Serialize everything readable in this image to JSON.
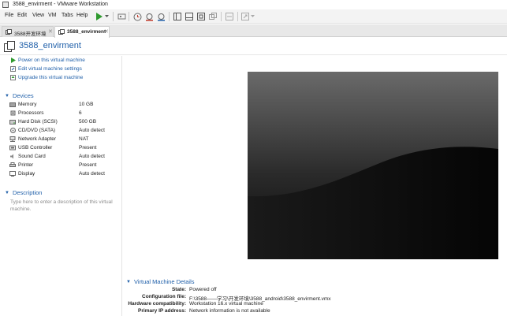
{
  "window": {
    "title": "3588_envirment - VMware Workstation"
  },
  "menu": [
    "File",
    "Edit",
    "View",
    "VM",
    "Tabs",
    "Help"
  ],
  "toolbar_icons": [
    "power-on-icon",
    "dropdown-icon",
    "send-ctrl-alt-del-icon",
    "snapshot-icon",
    "revert-snapshot-icon",
    "snapshot-manager-icon",
    "show-library-icon",
    "thumbnail-bar-icon",
    "full-screen-icon",
    "unity-icon",
    "console-view-icon",
    "stretch-guest-icon"
  ],
  "tabs": [
    {
      "label": "3588开发环境",
      "active": false
    },
    {
      "label": "3588_envirment",
      "active": true
    }
  ],
  "vm": {
    "name": "3588_envirment"
  },
  "actions": [
    {
      "label": "Power on this virtual machine",
      "icon": "play-icon"
    },
    {
      "label": "Edit virtual machine settings",
      "icon": "edit-settings-icon"
    },
    {
      "label": "Upgrade this virtual machine",
      "icon": "upgrade-icon"
    }
  ],
  "devices": {
    "header": "Devices",
    "items": [
      {
        "name": "Memory",
        "value": "10 GB",
        "icon": "memory-icon"
      },
      {
        "name": "Processors",
        "value": "6",
        "icon": "processor-icon"
      },
      {
        "name": "Hard Disk (SCSI)",
        "value": "500 GB",
        "icon": "hard-disk-icon"
      },
      {
        "name": "CD/DVD (SATA)",
        "value": "Auto detect",
        "icon": "cd-dvd-icon"
      },
      {
        "name": "Network Adapter",
        "value": "NAT",
        "icon": "network-adapter-icon"
      },
      {
        "name": "USB Controller",
        "value": "Present",
        "icon": "usb-controller-icon"
      },
      {
        "name": "Sound Card",
        "value": "Auto detect",
        "icon": "sound-card-icon"
      },
      {
        "name": "Printer",
        "value": "Present",
        "icon": "printer-icon"
      },
      {
        "name": "Display",
        "value": "Auto detect",
        "icon": "display-icon"
      }
    ]
  },
  "description": {
    "header": "Description",
    "placeholder": "Type here to enter a description of this virtual machine."
  },
  "details": {
    "header": "Virtual Machine Details",
    "rows": [
      {
        "key": "State:",
        "value": "Powered off"
      },
      {
        "key": "Configuration file:",
        "value": "F:\\3588——学习\\开发环境\\3588_android\\3588_envirment.vmx"
      },
      {
        "key": "Hardware compatibility:",
        "value": "Workstation 16.x virtual machine"
      },
      {
        "key": "Primary IP address:",
        "value": "Network information is not available"
      }
    ]
  },
  "colors": {
    "accent": "#1f5fa9",
    "play_green": "#2e9a2e"
  }
}
